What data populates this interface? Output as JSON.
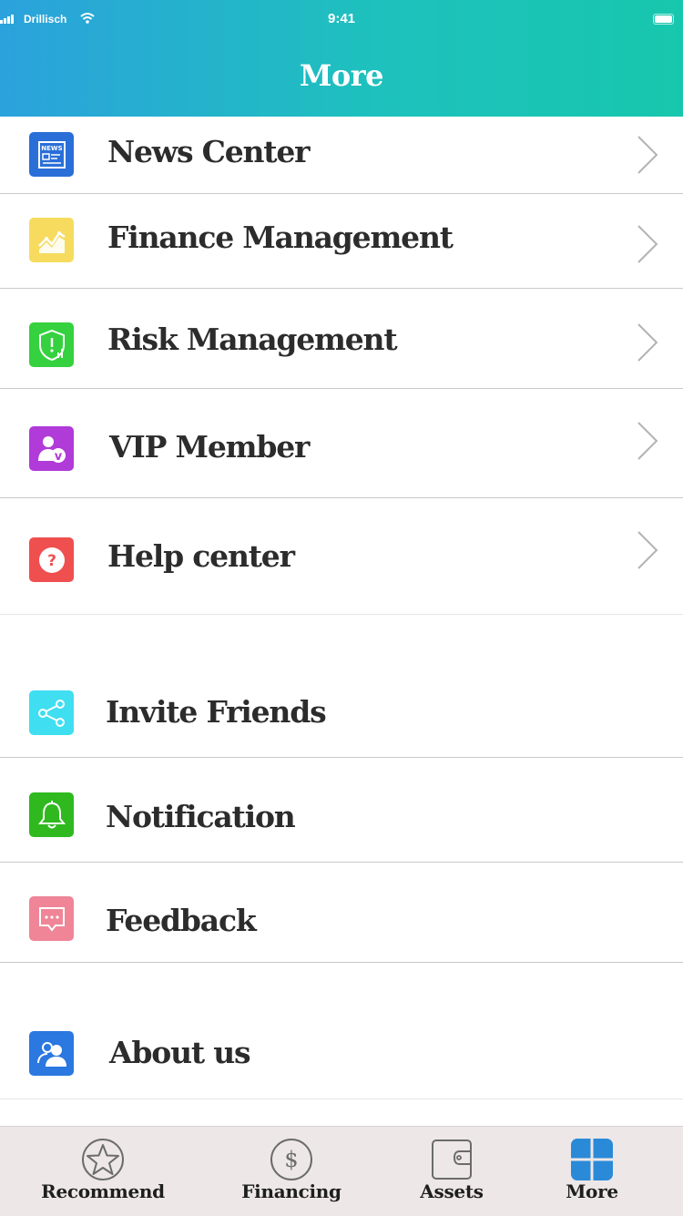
{
  "status_bar": {
    "carrier": "Drillisch",
    "time": "9:41"
  },
  "header": {
    "title": "More"
  },
  "menu": {
    "news": {
      "label": "News Center",
      "icon": "newspaper-icon",
      "color": "#2a6fd8"
    },
    "finance": {
      "label": "Finance Management",
      "icon": "chart-icon",
      "color": "#f6db5e"
    },
    "risk": {
      "label": "Risk Management",
      "icon": "shield-icon",
      "color": "#35d13f"
    },
    "vip": {
      "label": "VIP Member",
      "icon": "vip-user-icon",
      "color": "#b03bd8"
    },
    "help": {
      "label": "Help center",
      "icon": "question-icon",
      "color": "#ef4f4f"
    },
    "invite": {
      "label": "Invite Friends",
      "icon": "share-icon",
      "color": "#3fdef0"
    },
    "notify": {
      "label": "Notification",
      "icon": "bell-icon",
      "color": "#2fb91f"
    },
    "feedback": {
      "label": "Feedback",
      "icon": "chat-icon",
      "color": "#ef8597"
    },
    "about": {
      "label": "About us",
      "icon": "users-icon",
      "color": "#2a78e0"
    }
  },
  "tabbar": {
    "recommend": {
      "label": "Recommend",
      "icon": "star-icon"
    },
    "financing": {
      "label": "Financing",
      "icon": "dollar-icon"
    },
    "assets": {
      "label": "Assets",
      "icon": "wallet-icon"
    },
    "more": {
      "label": "More",
      "icon": "grid-icon",
      "active": true,
      "active_color": "#2a8ad8"
    }
  }
}
